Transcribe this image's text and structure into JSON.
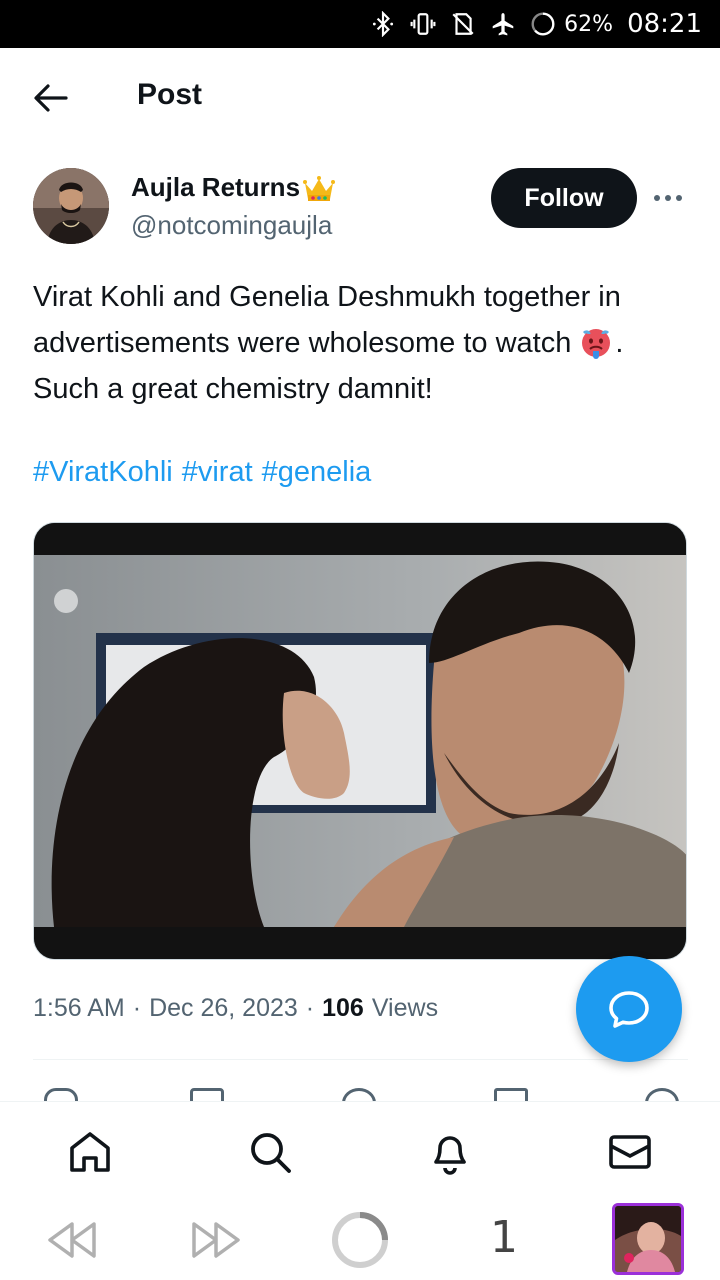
{
  "status_bar": {
    "battery": "62%",
    "time": "08:21",
    "icons": [
      "bluetooth-icon",
      "vibrate-icon",
      "no-sim-icon",
      "airplane-icon",
      "battery-ring-icon"
    ]
  },
  "header": {
    "title": "Post",
    "back_icon": "arrow-left-icon"
  },
  "post": {
    "author": {
      "name": "Aujla Returns",
      "name_emoji": "crown-icon",
      "handle": "@notcomingaujla"
    },
    "follow_label": "Follow",
    "text_line": "Virat Kohli and Genelia Deshmukh together in advertisements were wholesome to watch",
    "text_emoji": "hot-face-icon",
    "text_tail": ". Such a great chemistry damnit!",
    "hashtags": [
      "#ViratKohli",
      "#virat",
      "#genelia"
    ],
    "time": "1:56 AM",
    "date": "Dec 26, 2023",
    "separator": "·",
    "views_count": "106",
    "views_label": "Views"
  },
  "bottom_nav": {
    "items": [
      "home-icon",
      "search-icon",
      "bell-icon",
      "mail-icon"
    ]
  },
  "media_bar": {
    "count": "1",
    "icons": [
      "rewind-icon",
      "fast-forward-icon",
      "loading-ring-icon"
    ]
  },
  "colors": {
    "accent": "#1d9bf0",
    "text": "#0f1419",
    "secondary": "#536471",
    "follow_bg": "#0f1419"
  }
}
